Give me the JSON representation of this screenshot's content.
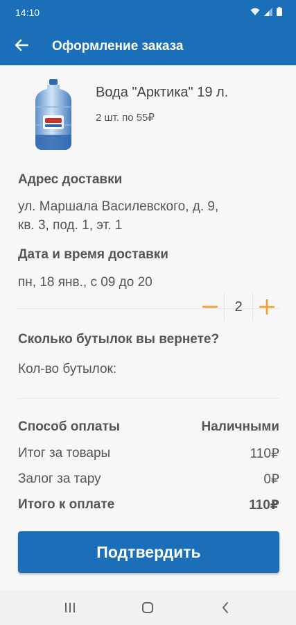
{
  "status_bar": {
    "time": "14:10"
  },
  "header": {
    "title": "Оформление заказа"
  },
  "product": {
    "name": "Вода \"Арктика\" 19 л.",
    "qty_text": "2 шт. по 55₽"
  },
  "delivery": {
    "address_label": "Адрес доставки",
    "address_line1": "ул. Маршала Василевского, д. 9,",
    "address_line2": "кв. 3, под. 1, эт. 1",
    "datetime_label": "Дата и время доставки",
    "datetime_value": "пн, 18 янв., с 09 до 20"
  },
  "bottles": {
    "question": "Сколько бутылок вы вернете?",
    "count_label": "Кол-во бутылок:",
    "count": "2",
    "minus": "−",
    "plus": "+"
  },
  "payment": {
    "method_label": "Способ оплаты",
    "method_value": "Наличными",
    "goods_label": "Итог за товары",
    "goods_value": "110₽",
    "deposit_label": "Залог за тару",
    "deposit_value": "0₽",
    "total_label": "Итого к оплате",
    "total_value": "110₽"
  },
  "confirm_label": "Подтвердить",
  "colors": {
    "primary": "#1a6fb8",
    "accent": "#f29f2b"
  }
}
